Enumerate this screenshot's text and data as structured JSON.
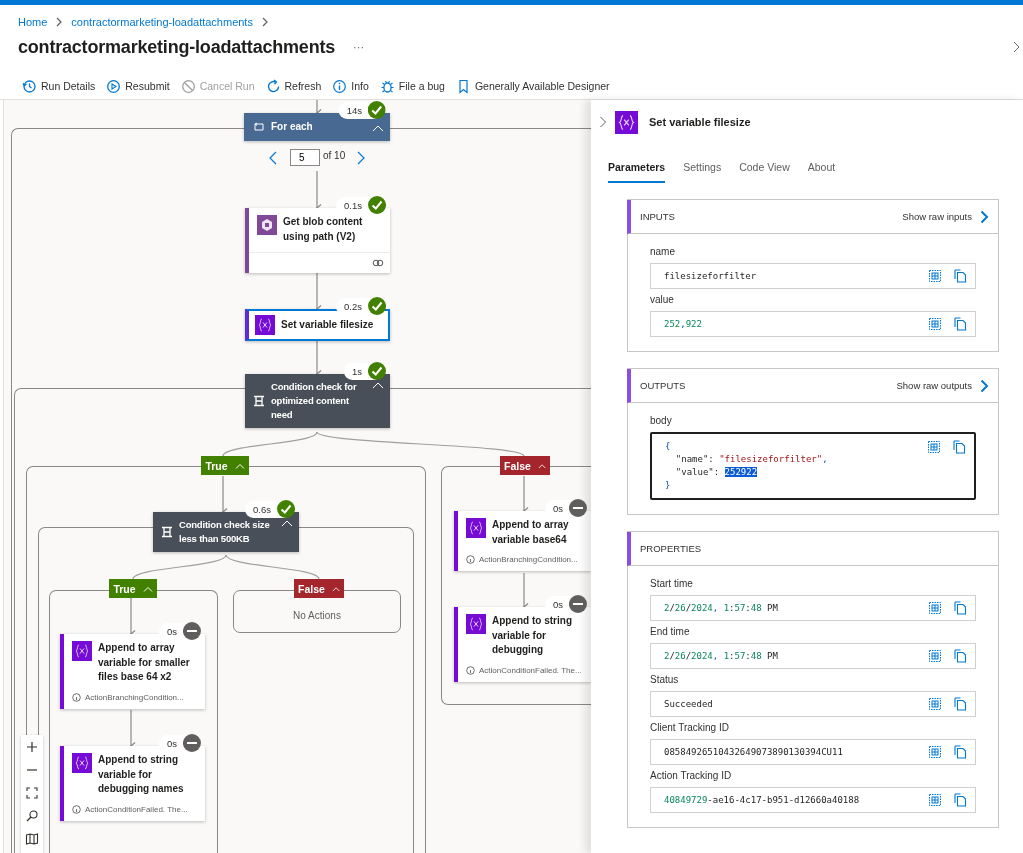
{
  "breadcrumb": [
    {
      "label": "Home"
    },
    {
      "label": "contractormarketing-loadattachments"
    }
  ],
  "title": "contractormarketing-loadattachments",
  "more": "···",
  "toolbar": [
    {
      "kind": "history",
      "label": "Run Details",
      "disabled": false
    },
    {
      "kind": "resubmit",
      "label": "Resubmit",
      "disabled": false
    },
    {
      "kind": "cancel",
      "label": "Cancel Run",
      "disabled": true
    },
    {
      "kind": "refresh",
      "label": "Refresh",
      "disabled": false
    },
    {
      "kind": "info",
      "label": "Info",
      "disabled": false
    },
    {
      "kind": "bug",
      "label": "File a bug",
      "disabled": false
    },
    {
      "kind": "bookmark",
      "label": "Generally Available Designer",
      "disabled": false
    }
  ],
  "flow": {
    "pager": {
      "value": "5",
      "total": "of 10"
    },
    "nodes": [
      {
        "kind": "loop",
        "title": "For each",
        "duration": "14s",
        "succeeded": true,
        "selected": false
      },
      {
        "kind": "storage",
        "title": "Get blob content using path (V2)",
        "duration": "0.1s",
        "succeeded": true,
        "selected": false
      },
      {
        "kind": "variable",
        "title": "Set variable filesize",
        "duration": "0.2s",
        "succeeded": true,
        "selected": true
      },
      {
        "kind": "condition",
        "title": "Condition check for optimized content need",
        "duration": "1s",
        "succeeded": true,
        "selected": false
      },
      {
        "kind": "condition",
        "title": "Condition check size less than 500KB",
        "duration": "0.6s",
        "succeeded": true,
        "selected": false
      },
      {
        "kind": "variable",
        "title": "Append to array variable for smaller files base 64 x2",
        "duration": "0s",
        "succeeded": false,
        "note": "ActionBranchingCondition...",
        "selected": false
      },
      {
        "kind": "variable",
        "title": "Append to string variable for debugging names",
        "duration": "0s",
        "succeeded": false,
        "note": "ActionConditionFailed. The...",
        "selected": false
      },
      {
        "kind": "variable",
        "title": "Append to array variable base64",
        "duration": "0s",
        "succeeded": false,
        "note": "ActionBranchingCondition...",
        "selected": false
      },
      {
        "kind": "variable",
        "title": "Append to string variable for debugging",
        "duration": "0s",
        "succeeded": false,
        "note": "ActionConditionFailed. The...",
        "selected": false
      }
    ],
    "branches": [
      {
        "kind": "true",
        "label": "True"
      },
      {
        "kind": "false",
        "label": "False"
      },
      {
        "kind": "true",
        "label": "True"
      },
      {
        "kind": "false",
        "label": "False"
      }
    ],
    "empty_branch": "No Actions"
  },
  "panel": {
    "title": "Set variable filesize",
    "tabs": [
      {
        "label": "Parameters",
        "selected": true
      },
      {
        "label": "Settings",
        "selected": false
      },
      {
        "label": "Code View",
        "selected": false
      },
      {
        "label": "About",
        "selected": false
      }
    ],
    "sections": [
      {
        "heading": "INPUTS",
        "raw_link": "Show raw inputs",
        "fields": [
          {
            "label": "name",
            "kind": "text",
            "value": [
              {
                "kind": "text",
                "text": "filesizeforfilter"
              }
            ]
          },
          {
            "label": "value",
            "kind": "text",
            "value": [
              {
                "kind": "number",
                "text": "252"
              },
              {
                "kind": "punct",
                "text": ","
              },
              {
                "kind": "number",
                "text": "922"
              }
            ]
          }
        ]
      },
      {
        "heading": "OUTPUTS",
        "raw_link": "Show raw outputs",
        "fields": [
          {
            "label": "body",
            "kind": "code",
            "lines": [
              [
                {
                  "kind": "brace",
                  "text": "{",
                  "selected": false
                }
              ],
              [
                {
                  "kind": "key",
                  "text": "  \"name\": ",
                  "selected": false
                },
                {
                  "kind": "string",
                  "text": "\"filesizeforfilter\"",
                  "selected": false
                },
                {
                  "kind": "punct",
                  "text": ",",
                  "selected": false
                }
              ],
              [
                {
                  "kind": "key",
                  "text": "  \"value\": ",
                  "selected": false
                },
                {
                  "kind": "number",
                  "text": "252922",
                  "selected": true
                }
              ],
              [
                {
                  "kind": "brace",
                  "text": "}",
                  "selected": false
                }
              ]
            ]
          }
        ]
      },
      {
        "heading": "PROPERTIES",
        "fields": [
          {
            "label": "Start time",
            "kind": "text",
            "value": [
              {
                "kind": "number",
                "text": "2"
              },
              {
                "kind": "text",
                "text": "/"
              },
              {
                "kind": "number",
                "text": "26"
              },
              {
                "kind": "text",
                "text": "/"
              },
              {
                "kind": "number",
                "text": "2024"
              },
              {
                "kind": "punct",
                "text": ", "
              },
              {
                "kind": "number",
                "text": "1"
              },
              {
                "kind": "text",
                "text": ":"
              },
              {
                "kind": "number",
                "text": "57"
              },
              {
                "kind": "text",
                "text": ":"
              },
              {
                "kind": "number",
                "text": "48"
              },
              {
                "kind": "text",
                "text": " PM"
              }
            ]
          },
          {
            "label": "End time",
            "kind": "text",
            "value": [
              {
                "kind": "number",
                "text": "2"
              },
              {
                "kind": "text",
                "text": "/"
              },
              {
                "kind": "number",
                "text": "26"
              },
              {
                "kind": "text",
                "text": "/"
              },
              {
                "kind": "number",
                "text": "2024"
              },
              {
                "kind": "punct",
                "text": ", "
              },
              {
                "kind": "number",
                "text": "1"
              },
              {
                "kind": "text",
                "text": ":"
              },
              {
                "kind": "number",
                "text": "57"
              },
              {
                "kind": "text",
                "text": ":"
              },
              {
                "kind": "number",
                "text": "48"
              },
              {
                "kind": "text",
                "text": " PM"
              }
            ]
          },
          {
            "label": "Status",
            "kind": "text",
            "value": [
              {
                "kind": "text",
                "text": "Succeeded"
              }
            ]
          },
          {
            "label": "Client Tracking ID",
            "kind": "text",
            "value": [
              {
                "kind": "text",
                "text": "08584926510432649073890130394CU11"
              }
            ]
          },
          {
            "label": "Action Tracking ID",
            "kind": "text",
            "value": [
              {
                "kind": "number",
                "text": "40849729"
              },
              {
                "kind": "text",
                "text": "-ae16-4c17-b951-d12660a40188"
              }
            ]
          }
        ]
      }
    ]
  }
}
